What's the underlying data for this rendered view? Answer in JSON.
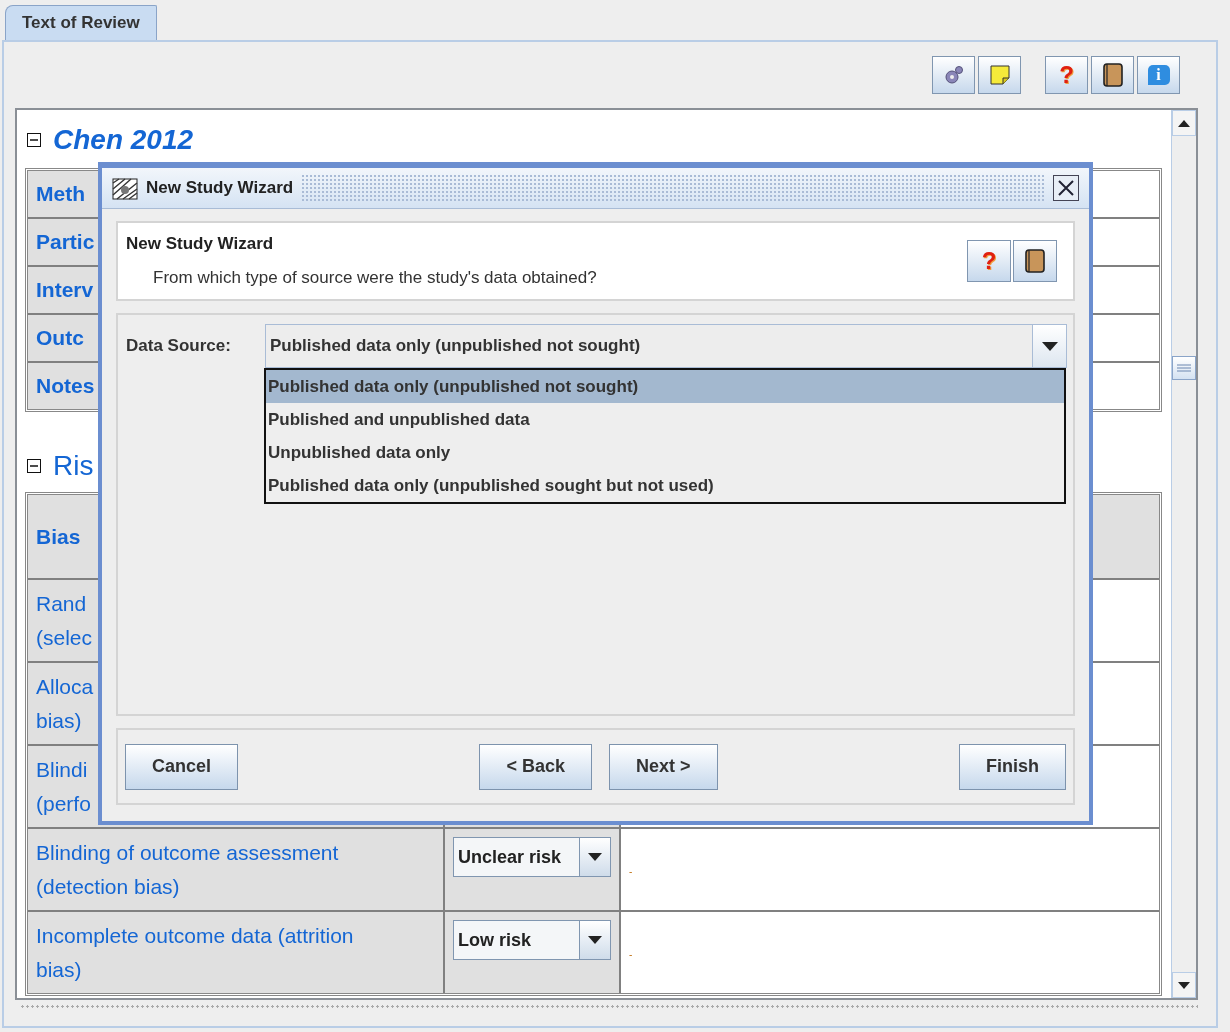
{
  "tab": {
    "label": "Text of Review",
    "selected": true
  },
  "toolbar": [
    {
      "kind": "gear"
    },
    {
      "kind": "note"
    },
    {
      "kind": "help",
      "glyph": "?"
    },
    {
      "kind": "book"
    },
    {
      "kind": "info",
      "glyph": "i"
    }
  ],
  "study": {
    "title": "Chen 2012",
    "expanded": true,
    "characteristics": [
      {
        "label": "Meth"
      },
      {
        "label": "Partic"
      },
      {
        "label": "Interv"
      },
      {
        "label": "Outc"
      },
      {
        "label": "Notes"
      }
    ],
    "risk_heading": "Ris",
    "risk_expanded": true,
    "risk_header": "Bias",
    "risk_rows": [
      {
        "bias": [
          "Rand",
          "(selec"
        ]
      },
      {
        "bias": [
          "Alloca",
          "bias)"
        ]
      },
      {
        "bias": [
          "Blindi",
          "(perfo"
        ]
      },
      {
        "bias": [
          "Blinding of outcome assessment (detection bias)"
        ],
        "judgement": "Unclear risk",
        "support": "-"
      },
      {
        "bias": [
          "Incomplete outcome data (attrition bias)"
        ],
        "judgement": "Low risk",
        "support": "-"
      }
    ]
  },
  "wizard": {
    "title": "New Study Wizard",
    "heading": "New Study Wizard",
    "question": "From which type of source were the study's data obtained?",
    "header_buttons": [
      {
        "kind": "help",
        "glyph": "?"
      },
      {
        "kind": "book"
      }
    ],
    "field_label": "Data Source:",
    "value": "Published data only (unpublished not sought)",
    "expanded": true,
    "options": [
      {
        "label": "Published data only (unpublished not sought)",
        "selected": true
      },
      {
        "label": "Published and unpublished data",
        "selected": false
      },
      {
        "label": "Unpublished data only",
        "selected": false
      },
      {
        "label": "Published data only (unpublished sought but not used)",
        "selected": false
      }
    ],
    "buttons": [
      {
        "label": "Cancel",
        "kind": "cancel"
      },
      {
        "label": "< Back",
        "kind": "back"
      },
      {
        "label": "Next >",
        "kind": "next"
      },
      {
        "label": "Finish",
        "kind": "finish"
      }
    ]
  }
}
